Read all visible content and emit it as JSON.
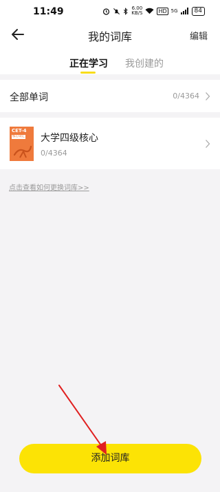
{
  "status_bar": {
    "time": "11:49",
    "net_speed_top": "6.00",
    "net_speed_unit": "KB/S",
    "signal_label": "5G",
    "hd_label": "HD",
    "battery": "84"
  },
  "header": {
    "title": "我的词库",
    "edit_label": "编辑"
  },
  "tabs": [
    {
      "label": "正在学习",
      "active": true
    },
    {
      "label": "我创建的",
      "active": false
    }
  ],
  "all_words": {
    "label": "全部单词",
    "count": "0/4364"
  },
  "books": [
    {
      "cover_title": "CET-4",
      "cover_subtitle": "核心词汇",
      "name": "大学四级核心",
      "count": "0/4364"
    }
  ],
  "help_link": "点击查看如何更换词库>>",
  "add_button_label": "添加词库",
  "colors": {
    "accent_yellow": "#fce305",
    "tab_underline": "#f8dc1a",
    "cover_orange": "#ef7a3c",
    "annotation_arrow": "#e02020"
  }
}
